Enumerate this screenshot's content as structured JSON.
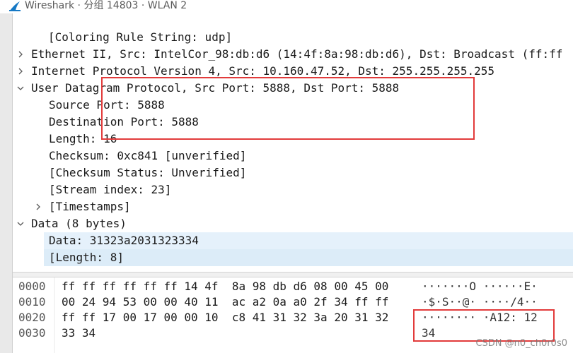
{
  "window": {
    "title": "Wireshark · 分组 14803 · WLAN 2",
    "logo_icon": "wireshark-fin-icon"
  },
  "tree": {
    "rows": [
      {
        "text": "[Coloring Rule String: udp]"
      },
      {
        "text": "Ethernet II, Src: IntelCor_98:db:d6 (14:4f:8a:98:db:d6), Dst: Broadcast (ff:ff"
      },
      {
        "text": "Internet Protocol Version 4, Src: 10.160.47.52, Dst: 255.255.255.255"
      },
      {
        "text": "User Datagram Protocol, Src Port: 5888, Dst Port: 5888"
      },
      {
        "text": "Source Port: 5888"
      },
      {
        "text": "Destination Port: 5888"
      },
      {
        "text": "Length: 16"
      },
      {
        "text": "Checksum: 0xc841 [unverified]"
      },
      {
        "text": "[Checksum Status: Unverified]"
      },
      {
        "text": "[Stream index: 23]"
      },
      {
        "text": "[Timestamps]"
      },
      {
        "text": "Data (8 bytes)"
      },
      {
        "text": "Data: 31323a2031323334"
      },
      {
        "text": "[Length: 8]"
      }
    ]
  },
  "bytes": {
    "rows": [
      {
        "offset": "0000",
        "hex": "ff ff ff ff ff ff 14 4f  8a 98 db d6 08 00 45 00",
        "ascii": "·······O ······E·"
      },
      {
        "offset": "0010",
        "hex": "00 24 94 53 00 00 40 11  ac a2 0a a0 2f 34 ff ff",
        "ascii": "·$·S··@· ····/4··"
      },
      {
        "offset": "0020",
        "hex": "ff ff 17 00 17 00 00 10  c8 41 31 32 3a 20 31 32",
        "ascii": "········ ·A12: 12"
      },
      {
        "offset": "0030",
        "hex": "33 34",
        "ascii": "34"
      }
    ]
  },
  "watermark": "CSDN @n0_ch0r0s0"
}
